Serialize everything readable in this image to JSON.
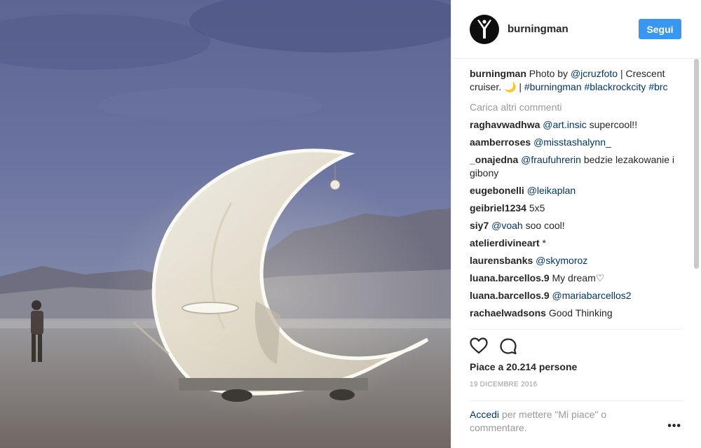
{
  "header": {
    "username": "burningman",
    "follow_label": "Segui"
  },
  "caption": {
    "username": "burningman",
    "text_before": "Photo by ",
    "mention": "@jcruzfoto",
    "text_after": " | Crescent cruiser. 🌙 | ",
    "hashtags": [
      "#burningman",
      "#blackrockcity",
      "#brc"
    ]
  },
  "load_more_label": "Carica altri commenti",
  "comments": [
    {
      "user": "raghavwadhwa",
      "mention": "@art.insic",
      "text": " supercool!!"
    },
    {
      "user": "aamberroses",
      "mention": "@misstashalynn_",
      "text": ""
    },
    {
      "user": "_onajedna",
      "mention": "@fraufuhrerin",
      "text": " bedzie lezakowanie i gibony"
    },
    {
      "user": "eugebonelli",
      "mention": "@leikaplan",
      "text": ""
    },
    {
      "user": "geibriel1234",
      "mention": "",
      "text": "5x5"
    },
    {
      "user": "siy7",
      "mention": "@voah",
      "text": " soo cool!"
    },
    {
      "user": "atelierdivineart",
      "mention": "",
      "text": "*"
    },
    {
      "user": "laurensbanks",
      "mention": "@skymoroz",
      "text": ""
    },
    {
      "user": "luana.barcellos.9",
      "mention": "",
      "text": "My dream♡"
    },
    {
      "user": "luana.barcellos.9",
      "mention": "@mariabarcellos2",
      "text": ""
    },
    {
      "user": "rachaelwadsons",
      "mention": "",
      "text": "Good Thinking"
    }
  ],
  "likes_text": "Piace a 20.214 persone",
  "date_text": "19 DICEMBRE 2016",
  "login": {
    "link": "Accedi",
    "text": " per mettere \"Mi piace\" o commentare."
  },
  "more_label": "•••",
  "icons": {
    "avatar": "burningman-logo-icon",
    "like": "heart-icon",
    "comment": "comment-bubble-icon"
  },
  "colors": {
    "follow_button": "#3897f0",
    "link": "#003569",
    "muted": "#999999"
  }
}
